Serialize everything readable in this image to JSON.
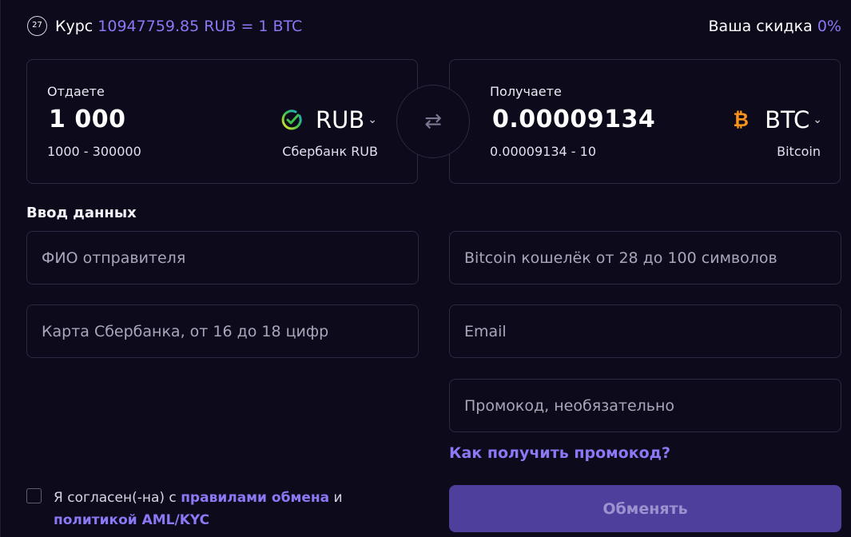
{
  "header": {
    "timer": "27",
    "rate_label": "Курс",
    "rate_value": "10947759.85 RUB = 1 BTC",
    "discount_label": "Ваша скидка",
    "discount_value": "0%"
  },
  "give": {
    "label": "Отдаете",
    "amount": "1 000",
    "range": "1000 - 300000",
    "currency": "RUB",
    "bank": "Сбербанк RUB",
    "icon": "sberbank-icon"
  },
  "swap": {
    "icon": "swap-arrows-icon",
    "glyph": "⇄"
  },
  "get": {
    "label": "Получаете",
    "amount": "0.00009134",
    "range": "0.00009134 - 10",
    "currency": "BTC",
    "network": "Bitcoin",
    "icon": "bitcoin-icon",
    "glyph": "₿"
  },
  "chevron": "⌄",
  "form": {
    "title": "Ввод данных",
    "sender_name_placeholder": "ФИО отправителя",
    "card_placeholder": "Карта Сбербанка, от 16 до 18 цифр",
    "wallet_placeholder": "Bitcoin кошелёк от 28 до 100 символов",
    "email_placeholder": "Email",
    "promo_placeholder": "Промокод, необязательно",
    "promo_link": "Как получить промокод?"
  },
  "agreement": {
    "text_before": "Я согласен(-на) с ",
    "rules_link": "правилами обмена",
    "and": " и ",
    "policy_link": "политикой AML/KYC"
  },
  "submit_label": "Обменять",
  "colors": {
    "accent": "#8a78f4",
    "background": "#0c0a1b",
    "border": "#2c2942",
    "button": "#4f3f9c",
    "bitcoin": "#f7931a"
  }
}
